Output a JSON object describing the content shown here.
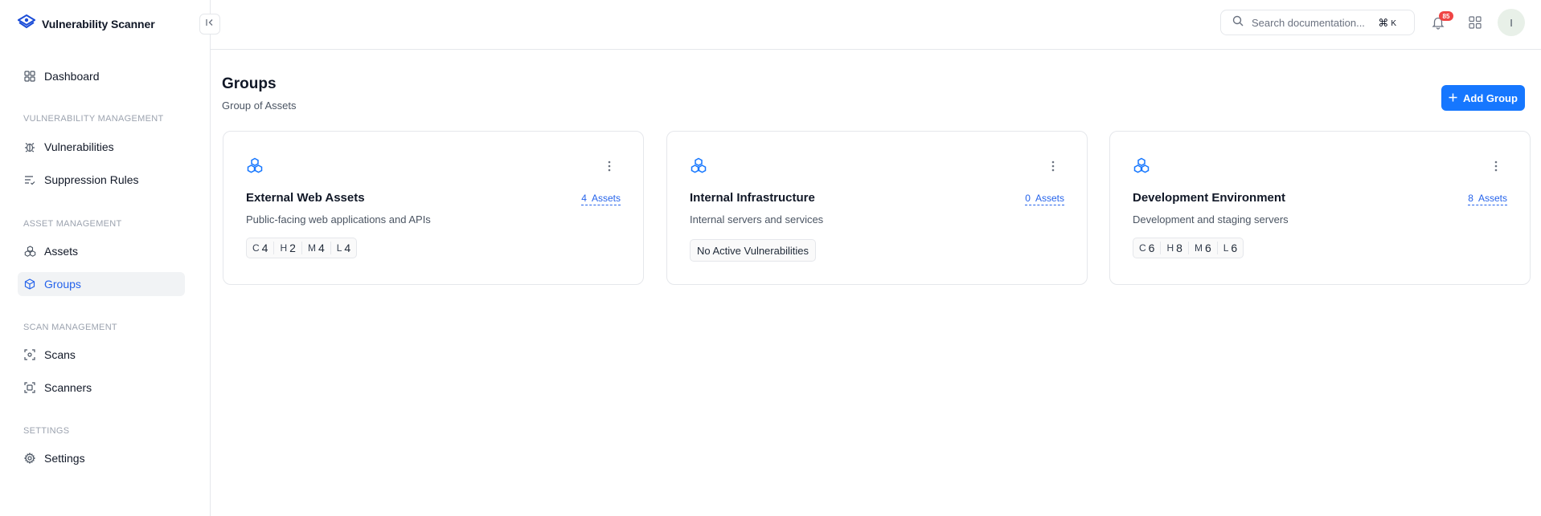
{
  "brand": {
    "name": "Vulnerability Scanner"
  },
  "colors": {
    "accent": "#1677ff",
    "active_text": "#2563eb",
    "badge": "#ef4444"
  },
  "sidebar": {
    "dashboard": "Dashboard",
    "sections": {
      "vuln": "VULNERABILITY MANAGEMENT",
      "asset": "ASSET MANAGEMENT",
      "scan": "SCAN MANAGEMENT",
      "settings": "SETTINGS"
    },
    "items": {
      "vulnerabilities": "Vulnerabilities",
      "suppression": "Suppression Rules",
      "assets": "Assets",
      "groups": "Groups",
      "scans": "Scans",
      "scanners": "Scanners",
      "settings": "Settings"
    }
  },
  "topbar": {
    "search_placeholder": "Search documentation...",
    "shortcut_key": "K",
    "notification_count": "85",
    "avatar_initial": "I"
  },
  "page": {
    "title": "Groups",
    "subtitle": "Group of Assets",
    "add_button": "Add Group"
  },
  "groups": [
    {
      "name": "External Web Assets",
      "description": "Public-facing web applications and APIs",
      "asset_count": "4",
      "asset_label": "Assets",
      "severity": {
        "c_label": "C",
        "c": "4",
        "h_label": "H",
        "h": "2",
        "m_label": "M",
        "m": "4",
        "l_label": "L",
        "l": "4"
      }
    },
    {
      "name": "Internal Infrastructure",
      "description": "Internal servers and services",
      "asset_count": "0",
      "asset_label": "Assets",
      "no_vuln_text": "No Active Vulnerabilities"
    },
    {
      "name": "Development Environment",
      "description": "Development and staging servers",
      "asset_count": "8",
      "asset_label": "Assets",
      "severity": {
        "c_label": "C",
        "c": "6",
        "h_label": "H",
        "h": "8",
        "m_label": "M",
        "m": "6",
        "l_label": "L",
        "l": "6"
      }
    }
  ]
}
